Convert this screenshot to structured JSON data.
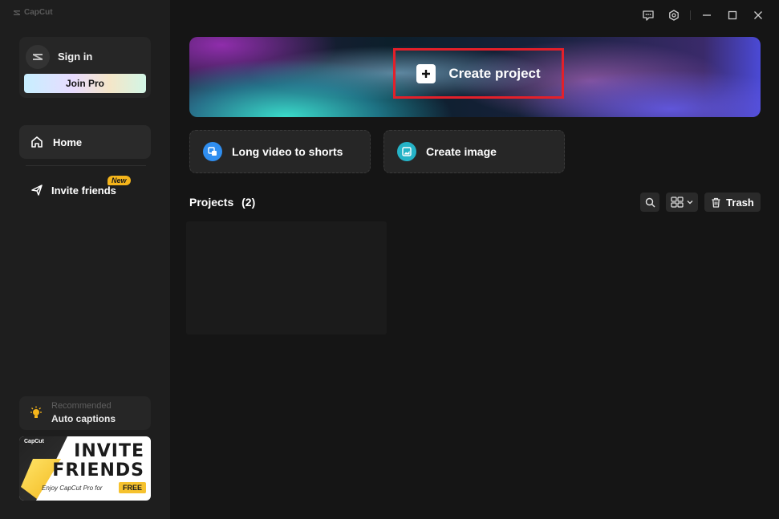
{
  "app": {
    "brand": "CapCut"
  },
  "account": {
    "signin_label": "Sign in",
    "join_pro_label": "Join Pro"
  },
  "nav": {
    "home_label": "Home",
    "invite_label": "Invite friends",
    "invite_badge": "New"
  },
  "recommended": {
    "label": "Recommended",
    "title": "Auto captions"
  },
  "promo": {
    "brand": "CapCut",
    "line1": "INVITE",
    "line2": "FRIENDS",
    "subline": "Enjoy CapCut Pro for",
    "free_tag": "FREE"
  },
  "titlebar": {
    "icons": [
      "feedback-icon",
      "settings-icon",
      "minimize-icon",
      "maximize-icon",
      "close-icon"
    ]
  },
  "hero": {
    "create_label": "Create project",
    "highlight_color": "#e3202a"
  },
  "features": [
    {
      "label": "Long video to shorts",
      "icon": "shorts-icon"
    },
    {
      "label": "Create image",
      "icon": "image-icon"
    }
  ],
  "projects": {
    "title": "Projects",
    "count": "(2)",
    "trash_label": "Trash"
  }
}
